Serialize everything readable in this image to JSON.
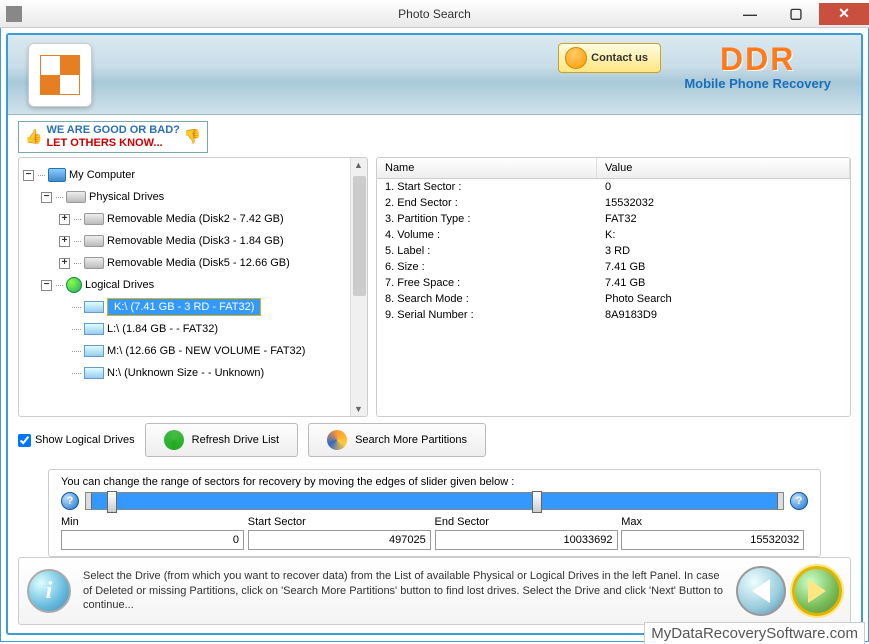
{
  "window": {
    "title": "Photo Search"
  },
  "banner": {
    "contact_label": "Contact us",
    "brand": "DDR",
    "brand_sub": "Mobile Phone Recovery"
  },
  "feedback": {
    "line1": "WE ARE GOOD OR BAD?",
    "line2": "LET OTHERS KNOW..."
  },
  "tree": {
    "root": "My Computer",
    "physical": "Physical Drives",
    "phys_items": [
      "Removable Media (Disk2 - 7.42 GB)",
      "Removable Media (Disk3 - 1.84 GB)",
      "Removable Media (Disk5 - 12.66 GB)"
    ],
    "logical": "Logical Drives",
    "log_items": [
      "K:\\ (7.41 GB - 3 RD - FAT32)",
      "L:\\ (1.84 GB -  - FAT32)",
      "M:\\ (12.66 GB - NEW VOLUME - FAT32)",
      "N:\\ (Unknown Size  -  - Unknown)"
    ]
  },
  "props": {
    "head_name": "Name",
    "head_value": "Value",
    "rows": [
      {
        "n": "1. Start Sector :",
        "v": "0"
      },
      {
        "n": "2. End Sector :",
        "v": "15532032"
      },
      {
        "n": "3. Partition Type :",
        "v": "FAT32"
      },
      {
        "n": "4. Volume :",
        "v": "K:"
      },
      {
        "n": "5. Label :",
        "v": "3 RD"
      },
      {
        "n": "6. Size :",
        "v": "7.41 GB"
      },
      {
        "n": "7. Free Space :",
        "v": "7.41 GB"
      },
      {
        "n": "8. Search Mode :",
        "v": "Photo Search"
      },
      {
        "n": "9. Serial Number :",
        "v": "8A9183D9"
      }
    ]
  },
  "controls": {
    "show_logical": "Show Logical Drives",
    "refresh": "Refresh Drive List",
    "search_more": "Search More Partitions"
  },
  "slider": {
    "instruction": "You can change the range of sectors for recovery by moving the edges of slider given below :",
    "min_label": "Min",
    "min_value": "0",
    "start_label": "Start Sector",
    "start_value": "497025",
    "end_label": "End Sector",
    "end_value": "10033692",
    "max_label": "Max",
    "max_value": "15532032"
  },
  "footer": {
    "text": "Select the Drive (from which you want to recover data) from the List of available Physical or Logical Drives in the left Panel. In case of Deleted or missing Partitions, click on 'Search More Partitions' button to find lost drives. Select the Drive and click 'Next' Button to continue..."
  },
  "watermark": "MyDataRecoverySoftware.com"
}
